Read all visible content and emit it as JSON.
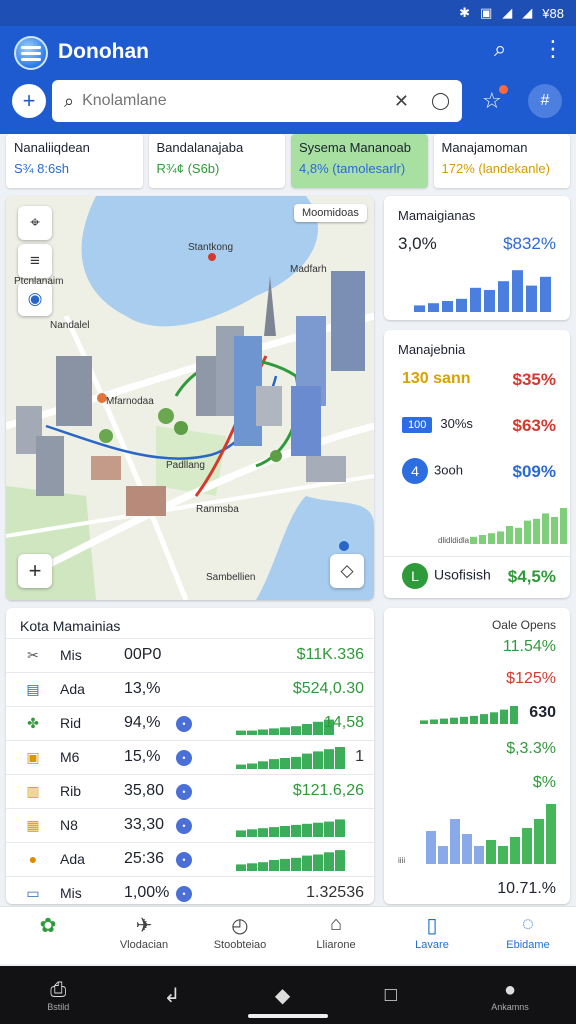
{
  "status_bar": {
    "time": "¥88",
    "icons": [
      "bluetooth-icon",
      "nfc-icon",
      "signal-icon",
      "wifi-icon"
    ]
  },
  "app": {
    "title": "Donohan"
  },
  "search": {
    "placeholder": "Knolamlane"
  },
  "stats": [
    {
      "title": "Nanaliiqdean",
      "value": "S¾ 8:6sh",
      "color": "#2a6ad8"
    },
    {
      "title": "Bandalanajaba",
      "value": "R¾¢ (S6b)",
      "color": "#2f9a3a"
    },
    {
      "title": "Sysema Mananoab",
      "value": "4,8% (tamolesarlr)",
      "color": "#2a6ad8"
    },
    {
      "title": "Manajamoman",
      "value": "172% (landekanle)",
      "color": "#d49b00"
    }
  ],
  "map": {
    "chip": "Moomidoas",
    "labels": {
      "a": "Stantkong",
      "b": "Madfarh",
      "c": "Ptcnlanaim",
      "d": "Nandalel",
      "e": "Mfarnodaa",
      "f": "Padllang",
      "g": "Ranmsba",
      "h": "Sambellien"
    }
  },
  "card1": {
    "title": "Mamaigianas",
    "left_value": "3,0%",
    "right_value": "$832%",
    "bars": [
      0.15,
      0.2,
      0.25,
      0.3,
      0.55,
      0.5,
      0.7,
      0.95,
      0.6,
      0.8
    ]
  },
  "card2": {
    "title": "Manajebnia",
    "rows": [
      {
        "left": "130 sann",
        "right": "$35%",
        "left_color": "#d6a300",
        "right_color": "#d23a2f"
      },
      {
        "pill": "100",
        "left": "30%s",
        "right": "$63%",
        "right_color": "#d23a2f"
      },
      {
        "icon": "4",
        "left": "3ooh",
        "right": "$09%",
        "right_color": "#2a6ad8"
      }
    ],
    "chart_caption": "dlidldidla",
    "bars": [
      0.2,
      0.25,
      0.3,
      0.35,
      0.5,
      0.45,
      0.65,
      0.7,
      0.85,
      0.75,
      1.0
    ],
    "footer": {
      "icon": "L",
      "label": "Usofisish",
      "value": "$4,5%"
    }
  },
  "table": {
    "title": "Kota Mamainias",
    "rows": [
      {
        "icon": "scissors-icon",
        "glyph": "✂",
        "name": "Mis",
        "pct": "00P0",
        "val": "$11K.336",
        "val_color": "#2f9a3a",
        "bars": []
      },
      {
        "icon": "card-icon",
        "glyph": "▤",
        "name": "Ada",
        "pct": "13,%",
        "val": "$524,0.30",
        "val_color": "#2f9a3a",
        "bars": []
      },
      {
        "icon": "group-icon",
        "glyph": "✤",
        "name": "Rid",
        "pct": "94,%",
        "val": "14,58",
        "val_color": "#2f9a3a",
        "bars": [
          0.2,
          0.2,
          0.25,
          0.3,
          0.35,
          0.4,
          0.5,
          0.6,
          0.7
        ]
      },
      {
        "icon": "box-icon",
        "glyph": "▣",
        "name": "M6",
        "pct": "15,%",
        "val": "1",
        "val_color": "#333",
        "bars": [
          0.2,
          0.25,
          0.35,
          0.45,
          0.5,
          0.55,
          0.7,
          0.8,
          0.9,
          1.0
        ]
      },
      {
        "icon": "folder-icon",
        "glyph": "▥",
        "name": "Rib",
        "pct": "35,80",
        "val": "$121.6,26",
        "val_color": "#2f9a3a",
        "bars": []
      },
      {
        "icon": "bag-icon",
        "glyph": "▦",
        "name": "N8",
        "pct": "33,30",
        "val": "",
        "val_color": "#333",
        "bars": [
          0.3,
          0.35,
          0.4,
          0.45,
          0.5,
          0.55,
          0.6,
          0.65,
          0.7,
          0.8
        ]
      },
      {
        "icon": "drop-icon",
        "glyph": "●",
        "name": "Ada",
        "pct": "25:36",
        "val": "",
        "val_color": "#333",
        "bars": [
          0.3,
          0.35,
          0.4,
          0.5,
          0.55,
          0.6,
          0.7,
          0.75,
          0.85,
          0.95
        ]
      },
      {
        "icon": "window-icon",
        "glyph": "▭",
        "name": "Mis",
        "pct": "1,00%",
        "val": "1.32536",
        "val_color": "#333",
        "bars": []
      }
    ]
  },
  "side": {
    "title": "Oale Opens",
    "values": [
      {
        "v": "11.54%",
        "color": "#2f9a3a"
      },
      {
        "v": "$125%",
        "color": "#d23a2f"
      },
      {
        "v": "630",
        "color": "#1d2230"
      },
      {
        "v": "$,3.3%",
        "color": "#2f9a3a"
      },
      {
        "v": "$%",
        "color": "#2f9a3a"
      },
      {
        "v": "10.71.%",
        "color": "#333"
      }
    ],
    "bars": [
      0.55,
      0.3,
      0.75,
      0.5,
      0.3,
      0.4,
      0.3,
      0.45,
      0.6,
      0.75,
      1.0
    ],
    "caption": "iiii"
  },
  "nav": {
    "items": [
      {
        "label": "",
        "icon": "brand-icon"
      },
      {
        "label": "Vlodacian",
        "icon": "rocket-icon"
      },
      {
        "label": "Stoobteiao",
        "icon": "clock-icon"
      },
      {
        "label": "Lliarone",
        "icon": "home-icon"
      },
      {
        "label": "Lavare",
        "icon": "tablet-icon"
      },
      {
        "label": "Ebidame",
        "icon": "chat-icon"
      }
    ]
  },
  "system_nav": {
    "left_label": "Bstild",
    "right_label": "Ankamns"
  }
}
